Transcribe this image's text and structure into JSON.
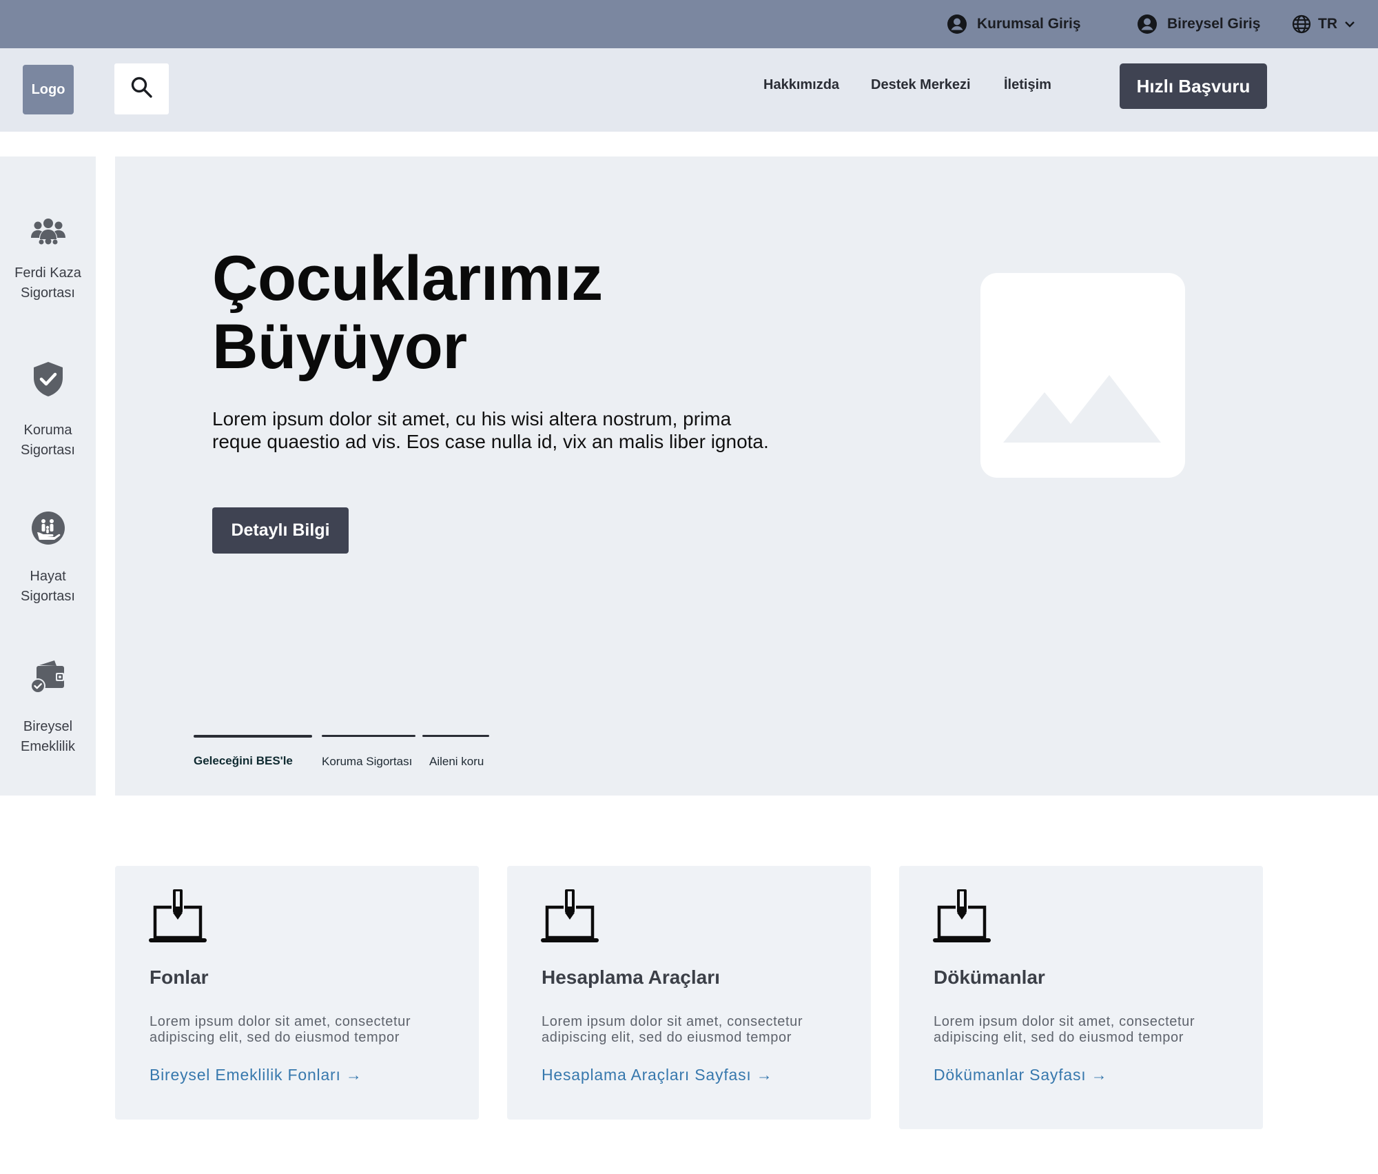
{
  "topbar": {
    "corporate_login": "Kurumsal Giriş",
    "individual_login": "Bireysel Giriş",
    "language": "TR"
  },
  "header": {
    "logo": "Logo",
    "nav": [
      "Hakkımızda",
      "Destek Merkezi",
      "İletişim"
    ],
    "cta": "Hızlı Başvuru"
  },
  "sidebar": {
    "items": [
      {
        "label_line1": "Ferdi Kaza",
        "label_line2": "Sigortası",
        "icon": "users-group-icon"
      },
      {
        "label_line1": "Koruma",
        "label_line2": "Sigortası",
        "icon": "shield-check-icon"
      },
      {
        "label_line1": "Hayat",
        "label_line2": "Sigortası",
        "icon": "family-icon"
      },
      {
        "label_line1": "Bireysel",
        "label_line2": "Emeklilik",
        "icon": "wallet-check-icon"
      }
    ]
  },
  "hero": {
    "title_line1": "Çocuklarımız",
    "title_line2": "Büyüyor",
    "text_line1": "Lorem ipsum dolor sit amet, cu his wisi altera nostrum, prima",
    "text_line2": "reque quaestio ad vis. Eos case nulla id, vix an malis liber ignota.",
    "button": "Detaylı Bilgi",
    "tabs": [
      {
        "label": "Geleceğini BES'le",
        "active": true
      },
      {
        "label": "Koruma Sigortası",
        "active": false
      },
      {
        "label": "Aileni koru",
        "active": false
      }
    ]
  },
  "cards": [
    {
      "title": "Fonlar",
      "desc_line1": "Lorem ipsum dolor sit amet, consectetur",
      "desc_line2": "adipiscing elit, sed do eiusmod tempor",
      "link": "Bireysel Emeklilik Fonları →"
    },
    {
      "title": "Hesaplama Araçları",
      "desc_line1": "Lorem ipsum dolor sit amet, consectetur",
      "desc_line2": "adipiscing elit, sed do eiusmod tempor",
      "link": "Hesaplama Araçları Sayfası →"
    },
    {
      "title": "Dökümanlar",
      "desc_line1": "Lorem ipsum dolor sit amet, consectetur",
      "desc_line2": "adipiscing elit, sed do eiusmod tempor",
      "link": "Dökümanlar Sayfası →"
    }
  ],
  "colors": {
    "topbar": "#7b87a0",
    "header": "#e4e8ef",
    "panel": "#eceff3",
    "dark_button": "#3f4352",
    "link": "#3778ad"
  }
}
